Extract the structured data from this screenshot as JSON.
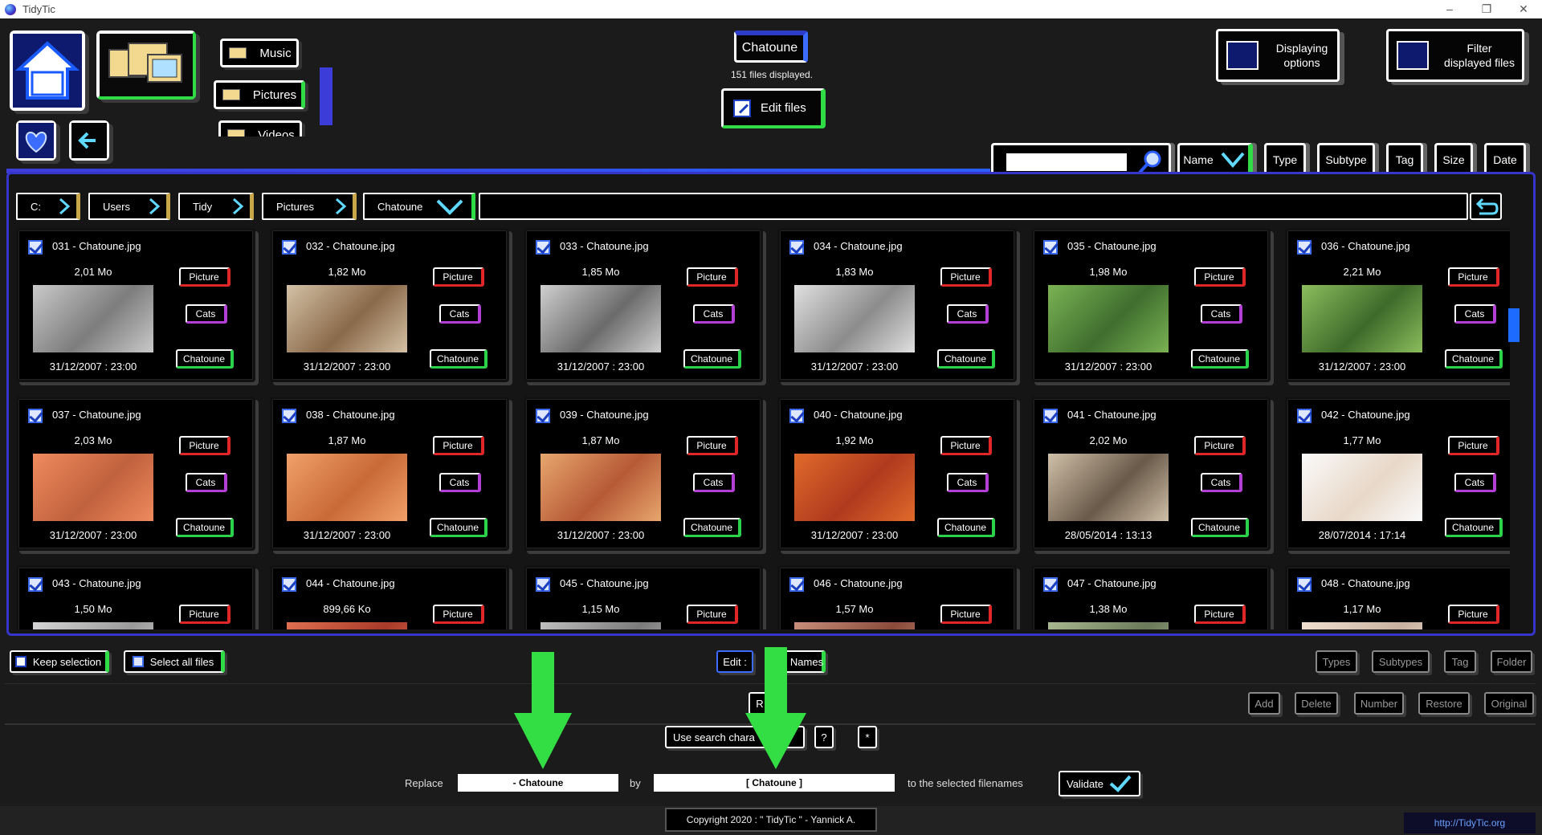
{
  "window": {
    "title": "TidyTic"
  },
  "nav": {
    "music": "Music",
    "pictures": "Pictures",
    "videos": "Videos"
  },
  "header": {
    "folder": "Chatoune",
    "count": "151 files displayed.",
    "edit_files": "Edit files",
    "displaying_options": [
      "Displaying",
      "options"
    ],
    "filter": [
      "Filter",
      "displayed files"
    ]
  },
  "search": {
    "value": ""
  },
  "sort": [
    "Name",
    "Type",
    "Subtype",
    "Tag",
    "Size",
    "Date"
  ],
  "breadcrumb": [
    "C:",
    "Users",
    "Tidy",
    "Pictures",
    "Chatoune"
  ],
  "files": [
    {
      "name": "031 - Chatoune.jpg",
      "size": "2,01 Mo",
      "date": "31/12/2007 : 23:00",
      "type": "Picture",
      "subtype": "Cats",
      "tag": "Chatoune"
    },
    {
      "name": "032 - Chatoune.jpg",
      "size": "1,82 Mo",
      "date": "31/12/2007 : 23:00",
      "type": "Picture",
      "subtype": "Cats",
      "tag": "Chatoune"
    },
    {
      "name": "033 - Chatoune.jpg",
      "size": "1,85 Mo",
      "date": "31/12/2007 : 23:00",
      "type": "Picture",
      "subtype": "Cats",
      "tag": "Chatoune"
    },
    {
      "name": "034 - Chatoune.jpg",
      "size": "1,83 Mo",
      "date": "31/12/2007 : 23:00",
      "type": "Picture",
      "subtype": "Cats",
      "tag": "Chatoune"
    },
    {
      "name": "035 - Chatoune.jpg",
      "size": "1,98 Mo",
      "date": "31/12/2007 : 23:00",
      "type": "Picture",
      "subtype": "Cats",
      "tag": "Chatoune"
    },
    {
      "name": "036 - Chatoune.jpg",
      "size": "2,21 Mo",
      "date": "31/12/2007 : 23:00",
      "type": "Picture",
      "subtype": "Cats",
      "tag": "Chatoune"
    },
    {
      "name": "037 - Chatoune.jpg",
      "size": "2,03 Mo",
      "date": "31/12/2007 : 23:00",
      "type": "Picture",
      "subtype": "Cats",
      "tag": "Chatoune"
    },
    {
      "name": "038 - Chatoune.jpg",
      "size": "1,87 Mo",
      "date": "31/12/2007 : 23:00",
      "type": "Picture",
      "subtype": "Cats",
      "tag": "Chatoune"
    },
    {
      "name": "039 - Chatoune.jpg",
      "size": "1,87 Mo",
      "date": "31/12/2007 : 23:00",
      "type": "Picture",
      "subtype": "Cats",
      "tag": "Chatoune"
    },
    {
      "name": "040 - Chatoune.jpg",
      "size": "1,92 Mo",
      "date": "31/12/2007 : 23:00",
      "type": "Picture",
      "subtype": "Cats",
      "tag": "Chatoune"
    },
    {
      "name": "041 - Chatoune.jpg",
      "size": "2,02 Mo",
      "date": "28/05/2014 : 13:13",
      "type": "Picture",
      "subtype": "Cats",
      "tag": "Chatoune"
    },
    {
      "name": "042 - Chatoune.jpg",
      "size": "1,77 Mo",
      "date": "28/07/2014 : 17:14",
      "type": "Picture",
      "subtype": "Cats",
      "tag": "Chatoune"
    },
    {
      "name": "043 - Chatoune.jpg",
      "size": "1,50 Mo",
      "date": "",
      "type": "Picture",
      "subtype": "",
      "tag": ""
    },
    {
      "name": "044 - Chatoune.jpg",
      "size": "899,66 Ko",
      "date": "",
      "type": "Picture",
      "subtype": "",
      "tag": ""
    },
    {
      "name": "045 - Chatoune.jpg",
      "size": "1,15 Mo",
      "date": "",
      "type": "Picture",
      "subtype": "",
      "tag": ""
    },
    {
      "name": "046 - Chatoune.jpg",
      "size": "1,57 Mo",
      "date": "",
      "type": "Picture",
      "subtype": "",
      "tag": ""
    },
    {
      "name": "047 - Chatoune.jpg",
      "size": "1,38 Mo",
      "date": "",
      "type": "Picture",
      "subtype": "",
      "tag": ""
    },
    {
      "name": "048 - Chatoune.jpg",
      "size": "1,17 Mo",
      "date": "",
      "type": "Picture",
      "subtype": "",
      "tag": ""
    }
  ],
  "bottom": {
    "keep_selection": "Keep selection",
    "select_all": "Select all files",
    "edit_label": "Edit :",
    "names_label": "Names",
    "right_row1": [
      "Types",
      "Subtypes",
      "Tag",
      "Folder"
    ],
    "right_row2": [
      "Add",
      "Delete",
      "Number",
      "Restore",
      "Original"
    ],
    "r_label": "R",
    "use_search": "Use search chara",
    "q_btn": "?",
    "star_btn": "*",
    "replace_label": "Replace",
    "replace_value": "- Chatoune",
    "by_label": "by",
    "by_value": "[ Chatoune ]",
    "suffix": "to the selected filenames",
    "validate": "Validate",
    "copyright": "Copyright 2020 : \" TidyTic \" - Yannick A.",
    "url": "http://TidyTic.org"
  },
  "colors": {
    "accent_blue": "#3535c9",
    "green": "#2fdc46",
    "red": "#e02626",
    "purple": "#b33fd6",
    "arrow": "#33dd44"
  }
}
